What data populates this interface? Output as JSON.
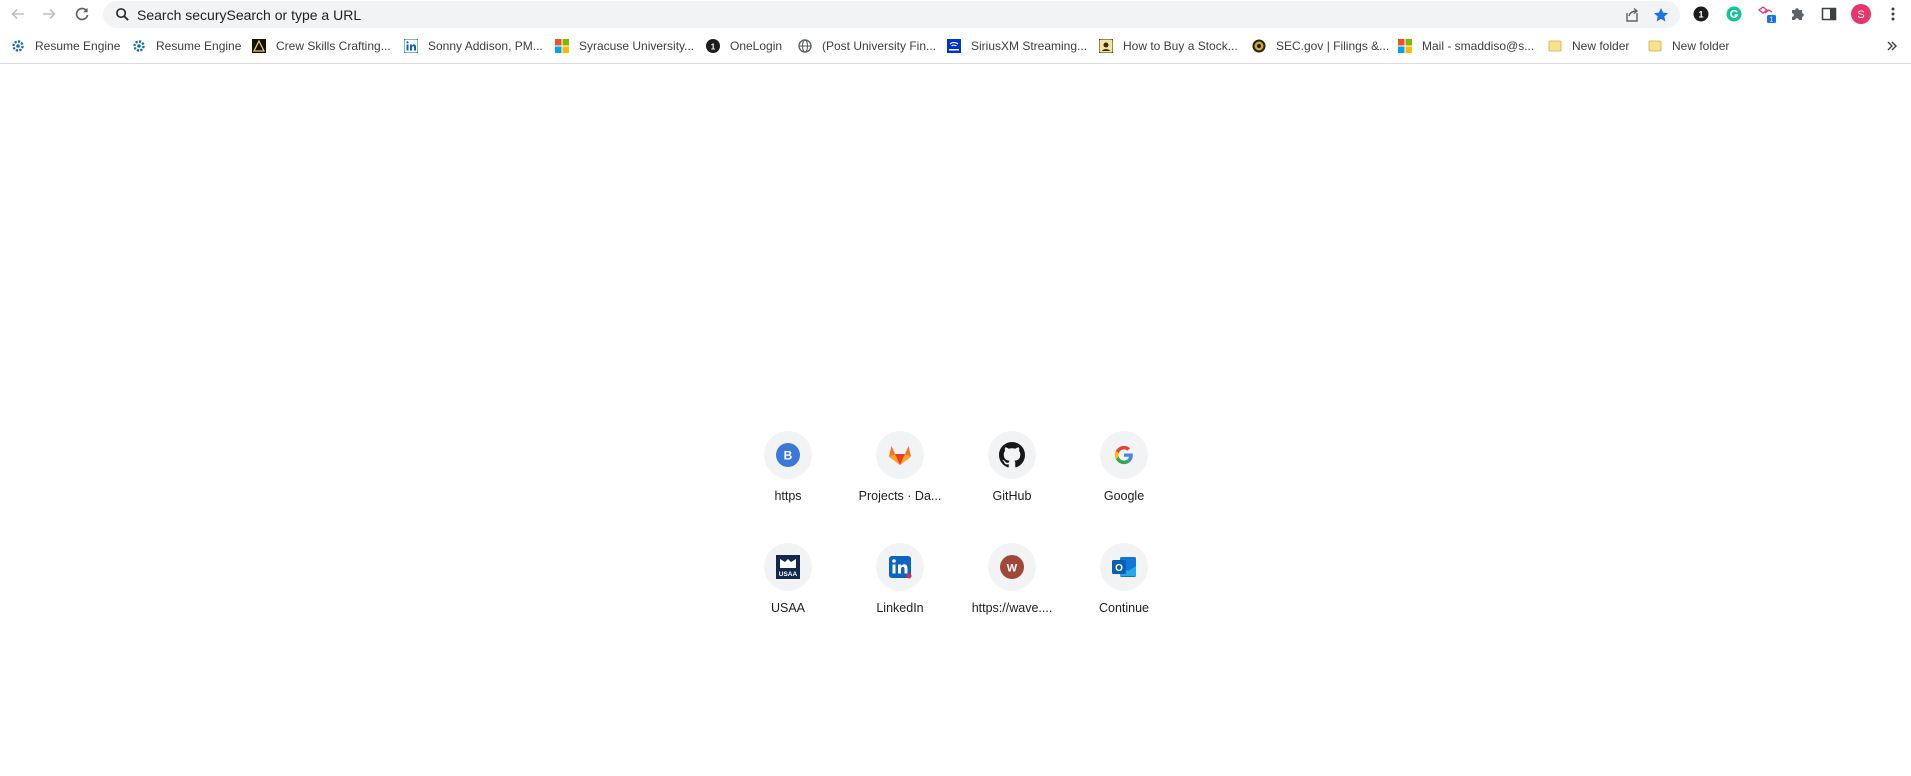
{
  "omnibox": {
    "placeholder": "Search securySearch or type a URL"
  },
  "bookmarks": [
    {
      "label": "Resume Engine",
      "icon": "gear-icon"
    },
    {
      "label": "Resume Engine",
      "icon": "gear-icon"
    },
    {
      "label": "Crew Skills Crafting...",
      "icon": "crew-skills-icon"
    },
    {
      "label": "Sonny Addison, PM...",
      "icon": "linkedin-icon"
    },
    {
      "label": "Syracuse University...",
      "icon": "microsoft-icon"
    },
    {
      "label": "OneLogin",
      "icon": "onelogin-icon"
    },
    {
      "label": "(Post University Fin...",
      "icon": "globe-icon"
    },
    {
      "label": "SiriusXM Streaming...",
      "icon": "siriusxm-icon"
    },
    {
      "label": "How to Buy a Stock...",
      "icon": "stock-icon"
    },
    {
      "label": "SEC.gov | Filings &...",
      "icon": "sec-seal-icon"
    },
    {
      "label": "Mail - smaddiso@s...",
      "icon": "microsoft-icon"
    },
    {
      "label": "New folder",
      "icon": "folder-icon"
    },
    {
      "label": "New folder",
      "icon": "folder-icon"
    }
  ],
  "profile": {
    "initial": "S",
    "color": "#e8336d"
  },
  "accent": "#1a73e8",
  "shortcuts": [
    {
      "label": "https",
      "icon": "b-letter-icon",
      "letter": "B"
    },
    {
      "label": "Projects · Da...",
      "icon": "gitlab-icon"
    },
    {
      "label": "GitHub",
      "icon": "github-icon"
    },
    {
      "label": "Google",
      "icon": "google-icon"
    },
    {
      "label": "USAA",
      "icon": "usaa-icon",
      "text": "USAA"
    },
    {
      "label": "LinkedIn",
      "icon": "linkedin-icon"
    },
    {
      "label": "https://wave....",
      "icon": "w-letter-icon",
      "letter": "W"
    },
    {
      "label": "Continue",
      "icon": "outlook-icon",
      "letter": "O"
    }
  ]
}
